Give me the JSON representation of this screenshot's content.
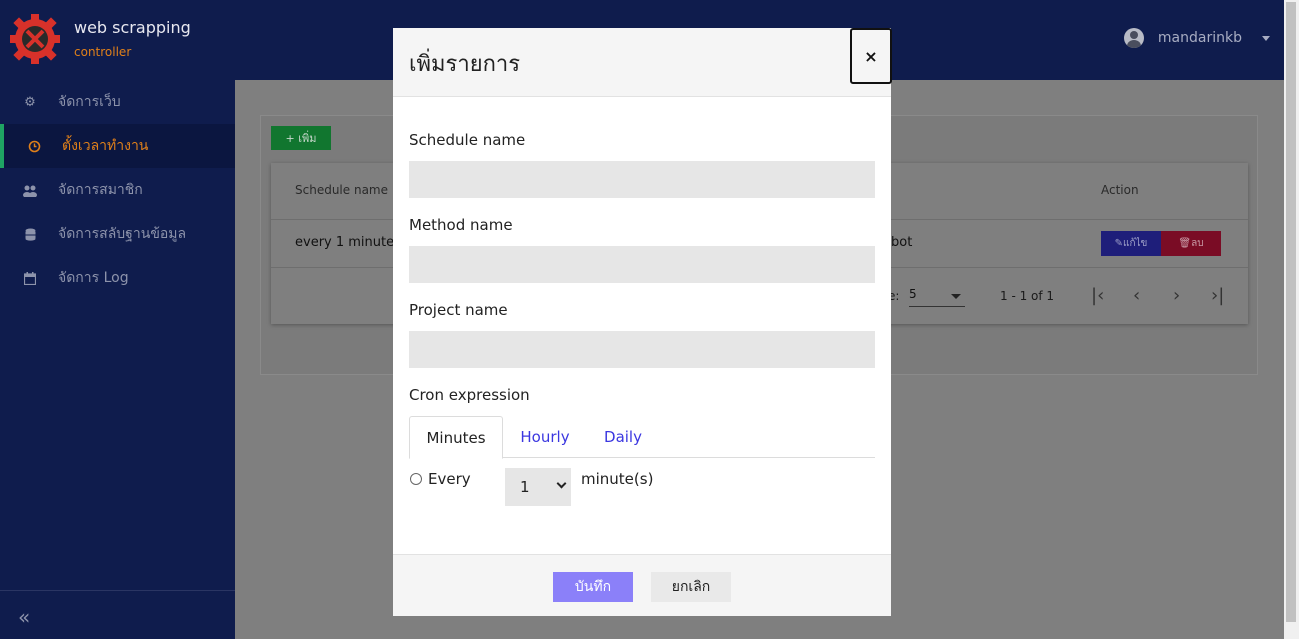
{
  "brand": {
    "title": "web scrapping",
    "subtitle": "controller",
    "icon": "gear-tools-logo",
    "accent": "#e0801a"
  },
  "sidebar": {
    "items": [
      {
        "label": "จัดการเว็บ",
        "icon": "gear-icon",
        "active": false
      },
      {
        "label": "ตั้งเวลาทำงาน",
        "icon": "clock-icon",
        "active": true
      },
      {
        "label": "จัดการสมาชิก",
        "icon": "users-icon",
        "active": false
      },
      {
        "label": "จัดการสลับฐานข้อมูล",
        "icon": "database-icon",
        "active": false
      },
      {
        "label": "จัดการ Log",
        "icon": "calendar-icon",
        "active": false
      }
    ],
    "collapse_icon": "double-chevron-left-icon"
  },
  "topbar": {
    "username": "mandarinkb"
  },
  "background_page": {
    "add_button": "+ เพิ่ม",
    "table": {
      "headers": [
        "Schedule name",
        "Action"
      ],
      "rows": [
        {
          "schedule_name": "every 1 minute",
          "project_partial": "bot"
        }
      ],
      "edit_label": "แก้ไข",
      "delete_label": "ลบ"
    },
    "pagination": {
      "rows_label": "e:",
      "rows_value": "5",
      "range": "1 - 1 of 1"
    }
  },
  "modal": {
    "title": "เพิ่มรายการ",
    "close_label": "×",
    "fields": {
      "schedule_name": {
        "label": "Schedule name",
        "value": ""
      },
      "method_name": {
        "label": "Method name",
        "value": ""
      },
      "project_name": {
        "label": "Project name",
        "value": ""
      }
    },
    "cron": {
      "label": "Cron expression",
      "tabs": [
        "Minutes",
        "Hourly",
        "Daily"
      ],
      "active_tab": "Minutes",
      "every_label": "Every",
      "minute_value": "1",
      "unit_label": "minute(s)"
    },
    "save_label": "บันทึก",
    "cancel_label": "ยกเลิก"
  },
  "colors": {
    "primary": "#8b80f9",
    "sidebar_bg": "#0f1c4d",
    "tab_link": "#3b37e0"
  }
}
